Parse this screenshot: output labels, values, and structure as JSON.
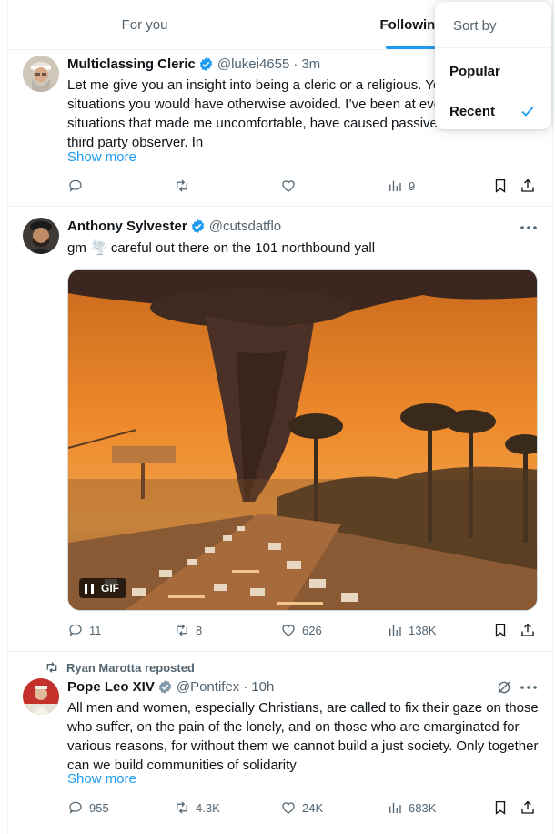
{
  "header": {
    "tabs": [
      "For you",
      "Following"
    ],
    "active_tab": "Following"
  },
  "sort_menu": {
    "title": "Sort by",
    "options": [
      "Popular",
      "Recent"
    ],
    "selected": "Recent"
  },
  "posts": [
    {
      "name": "Multiclassing Cleric",
      "handle": "@lukei4655",
      "dot": "·",
      "time": "3m",
      "text": "Let me give you an insight into being a cleric or a religious. You find yourself in situations you would have otherwise avoided. I’ve been at events and in situations that made me uncomfortable, have caused passive scandal to a third party observer. In",
      "show_more": "Show more",
      "stats": {
        "replies": "",
        "reposts": "",
        "likes": "",
        "views": "9"
      }
    },
    {
      "name": "Anthony Sylvester",
      "handle": "@cutsdatflo",
      "text": "gm 🌪️ careful out there on the 101 northbound yall",
      "media": {
        "type": "gif",
        "badge": "GIF"
      },
      "stats": {
        "replies": "11",
        "reposts": "8",
        "likes": "626",
        "views": "138K"
      }
    },
    {
      "repost_label": "Ryan Marotta reposted",
      "name": "Pope Leo XIV",
      "handle": "@Pontifex",
      "dot": "·",
      "time": "10h",
      "text": "All men and women, especially Christians, are called to fix their gaze on those who suffer, on the pain of the lonely, and on those who are emarginated for various reasons, for without them we cannot build a just society. Only together can we build communities of solidarity",
      "show_more": "Show more",
      "stats": {
        "replies": "955",
        "reposts": "4.3K",
        "likes": "24K",
        "views": "683K"
      }
    }
  ],
  "colors": {
    "accent": "#1d9bf0",
    "text": "#0f1419",
    "secondary": "#536471",
    "verified_gov": "#829aab",
    "border": "#eff3f4"
  }
}
